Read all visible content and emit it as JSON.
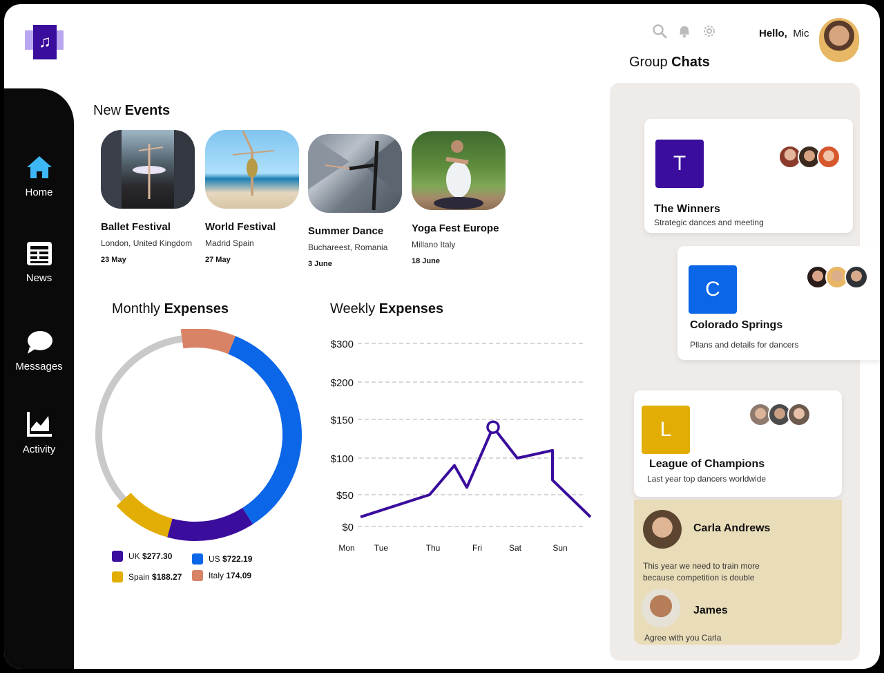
{
  "header": {
    "greeting": "Hello,",
    "user_name": "Mic",
    "icons": [
      "search-icon",
      "bell-icon",
      "gear-icon"
    ]
  },
  "sidebar": {
    "items": [
      {
        "label": "Home",
        "icon": "home-icon",
        "active": true
      },
      {
        "label": "News",
        "icon": "news-icon"
      },
      {
        "label": "Messages",
        "icon": "chat-bubble-icon"
      },
      {
        "label": "Activity",
        "icon": "activity-chart-icon"
      }
    ]
  },
  "events": {
    "title_regular": "New",
    "title_bold": "Events",
    "items": [
      {
        "name": "Ballet Festival",
        "location": "London, United Kingdom",
        "date": "23 May"
      },
      {
        "name": "World Festival",
        "location": "Madrid Spain",
        "date": "27 May"
      },
      {
        "name": "Summer Dance",
        "location": "Buchareest, Romania",
        "date": "3 June"
      },
      {
        "name": "Yoga Fest Europe",
        "location": "Millano Italy",
        "date": "18 June"
      }
    ]
  },
  "monthly": {
    "title_regular": "Monthly",
    "title_bold": "Expenses",
    "legend": [
      {
        "label": "UK",
        "value": "$277.30",
        "color": "#3a0d9c"
      },
      {
        "label": "US",
        "value": "$722.19",
        "color": "#0b66e8"
      },
      {
        "label": "Spain",
        "value": "$188.27",
        "color": "#e2ae06"
      },
      {
        "label": "Italy",
        "value": "174.09",
        "color": "#d98366"
      }
    ]
  },
  "weekly": {
    "title_regular": "Weekly",
    "title_bold": "Expenses"
  },
  "chart_data": [
    {
      "type": "pie",
      "title": "Monthly Expenses",
      "labels": [
        "UK",
        "US",
        "Spain",
        "Italy"
      ],
      "values": [
        277.3,
        722.19,
        188.27,
        174.09
      ],
      "colors": [
        "#3a0d9c",
        "#0b66e8",
        "#e2ae06",
        "#d98366"
      ]
    },
    {
      "type": "line",
      "title": "Weekly Expenses",
      "y_ticks": [
        "$300",
        "$200",
        "$150",
        "$100",
        "$50",
        "$0"
      ],
      "x_ticks": [
        "Mon",
        "Tue",
        "Thu",
        "Fri",
        "Sat",
        "Sun"
      ],
      "ylim": [
        0,
        300
      ],
      "series": [
        {
          "values": [
            {
              "x": "Mon",
              "y": 15
            },
            {
              "x": "Thu",
              "y": 50
            },
            {
              "x": "Thu",
              "y": 90
            },
            {
              "x": "Fri",
              "y": 60
            },
            {
              "x": "Fri",
              "y": 140
            },
            {
              "x": "Sat",
              "y": 100
            },
            {
              "x": "Sun",
              "y": 110
            },
            {
              "x": "Sun",
              "y": 70
            },
            {
              "x": "Sun",
              "y": 15
            }
          ],
          "color": "#3a0d9c",
          "highlight_y": 140
        }
      ]
    }
  ],
  "chats": {
    "title_regular": "Group",
    "title_bold": "Chats",
    "groups": [
      {
        "initial": "T",
        "name": "The Winners",
        "desc": "Strategic dances and meeting",
        "color": "#3a0d9c"
      },
      {
        "initial": "C",
        "name": "Colorado Springs",
        "desc": "Pllans and details for dancers",
        "color": "#0b66e8"
      },
      {
        "initial": "L",
        "name": "League of Champions",
        "desc": "Last year top dancers worldwide",
        "color": "#e2ae06"
      }
    ],
    "messages": [
      {
        "name": "Carla Andrews",
        "text": "This year we need to train more because competition is double"
      },
      {
        "name": "James",
        "text": "Agree with you Carla"
      }
    ]
  }
}
